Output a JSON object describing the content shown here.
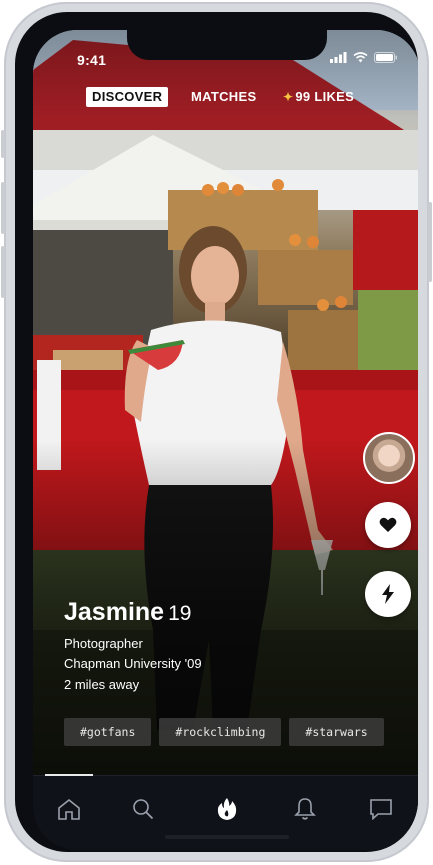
{
  "status_bar": {
    "time": "9:41"
  },
  "top_tabs": [
    {
      "label": "DISCOVER",
      "active": true
    },
    {
      "label": "MATCHES",
      "active": false
    },
    {
      "label": "99 LIKES",
      "active": false
    }
  ],
  "profile": {
    "name": "Jasmine",
    "age": "19",
    "occupation": "Photographer",
    "school": "Chapman University '09",
    "distance": "2 miles away",
    "tags": [
      "#gotfans",
      "#rockclimbing",
      "#starwars"
    ]
  },
  "actions": {
    "like": "heart-icon",
    "boost": "lightning-icon"
  },
  "bottom_nav": [
    {
      "icon": "home-icon",
      "active": false
    },
    {
      "icon": "search-icon",
      "active": false
    },
    {
      "icon": "flame-icon",
      "active": true
    },
    {
      "icon": "bell-icon",
      "active": false
    },
    {
      "icon": "chat-icon",
      "active": false
    }
  ],
  "colors": {
    "accent": "#ffffff",
    "likes_spark": "#f5c542",
    "nav_bg": "#0f1218"
  }
}
